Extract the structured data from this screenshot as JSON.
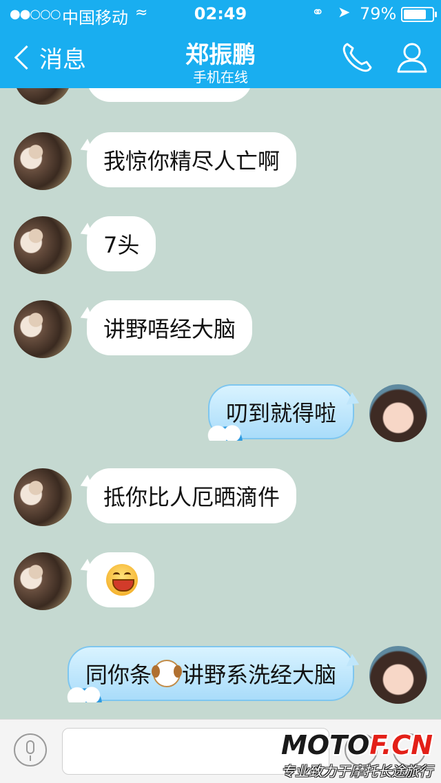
{
  "status": {
    "signal": "●●○○○",
    "carrier": "中国移动",
    "wifi": "wifi",
    "time": "02:49",
    "battery": "79%",
    "battery_level": 0.79
  },
  "nav": {
    "back_label": "消息",
    "title": "郑振鹏",
    "subtitle": "手机在线"
  },
  "messages": [
    {
      "side": "left",
      "text": ""
    },
    {
      "side": "left",
      "text": "我惊你精尽人亡啊"
    },
    {
      "side": "left",
      "text": "7头"
    },
    {
      "side": "left",
      "text": "讲野唔经大脑"
    },
    {
      "side": "right",
      "text": "叨到就得啦"
    },
    {
      "side": "left",
      "text": "抵你比人厄晒滴件"
    },
    {
      "side": "left",
      "text": "",
      "emoji": "grin-emoji"
    },
    {
      "side": "right",
      "text_before": "同你条",
      "emoji": "dog-emoji",
      "text_after": "讲野系洗经大脑"
    }
  ],
  "input": {
    "placeholder": ""
  },
  "watermark": {
    "brand_a": "MOTO",
    "brand_b": "F.CN",
    "slogan": "专业致力于摩托长途旅行"
  },
  "colors": {
    "header": "#19aef0",
    "chat_bg": "#c5d9d1",
    "bubble_left": "#ffffff",
    "bubble_right": "#bfe6fb"
  }
}
